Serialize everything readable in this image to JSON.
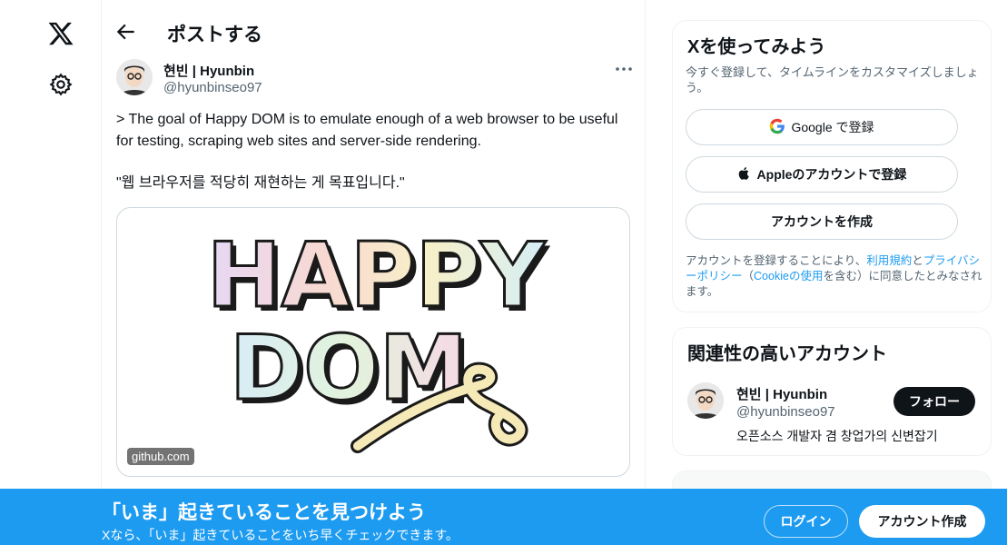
{
  "nav": {
    "logo_icon": "x-logo-icon",
    "settings_icon": "gear-icon"
  },
  "header": {
    "back_icon": "arrow-left-icon",
    "title": "ポストする"
  },
  "post": {
    "author_name": "현빈 | Hyunbin",
    "author_handle": "@hyunbinseo97",
    "more_icon": "ellipsis-icon",
    "text_line1": "> The goal of Happy DOM is to emulate enough of a web browser to be useful for testing, scraping web sites and server-side rendering.",
    "text_line2": "\"웹 브라우저를 적당히 재현하는 게 목표입니다.\"",
    "card": {
      "image_word1": "HAPPY",
      "image_word2": "DOM",
      "domain": "github.com"
    }
  },
  "signup_box": {
    "title": "Xを使ってみよう",
    "subtitle": "今すぐ登録して、タイムラインをカスタマイズしましょう。",
    "google_label": "Google で登録",
    "apple_label": "Appleのアカウントで登録",
    "create_label": "アカウントを作成",
    "legal_prefix": "アカウントを登録することにより、",
    "legal_terms": "利用規約",
    "legal_and": "と",
    "legal_privacy": "プライバシーポリシー",
    "legal_paren_open": "（",
    "legal_cookie": "Cookieの使用",
    "legal_suffix": "を含む）に同意したとみなされます。"
  },
  "related": {
    "title": "関連性の高いアカウント",
    "name": "현빈 | Hyunbin",
    "handle": "@hyunbinseo97",
    "bio": "오픈소스 개발자 겸 창업가의 신변잡기",
    "follow_label": "フォロー"
  },
  "banner": {
    "title": "「いま」起きていることを見つけよう",
    "subtitle": "Xなら、「いま」起きていることをいち早くチェックできます。",
    "login_label": "ログイン",
    "signup_label": "アカウント作成"
  },
  "colors": {
    "accent": "#1d9bf0",
    "text": "#0f1419",
    "muted": "#536471",
    "border": "#eff3f4"
  }
}
